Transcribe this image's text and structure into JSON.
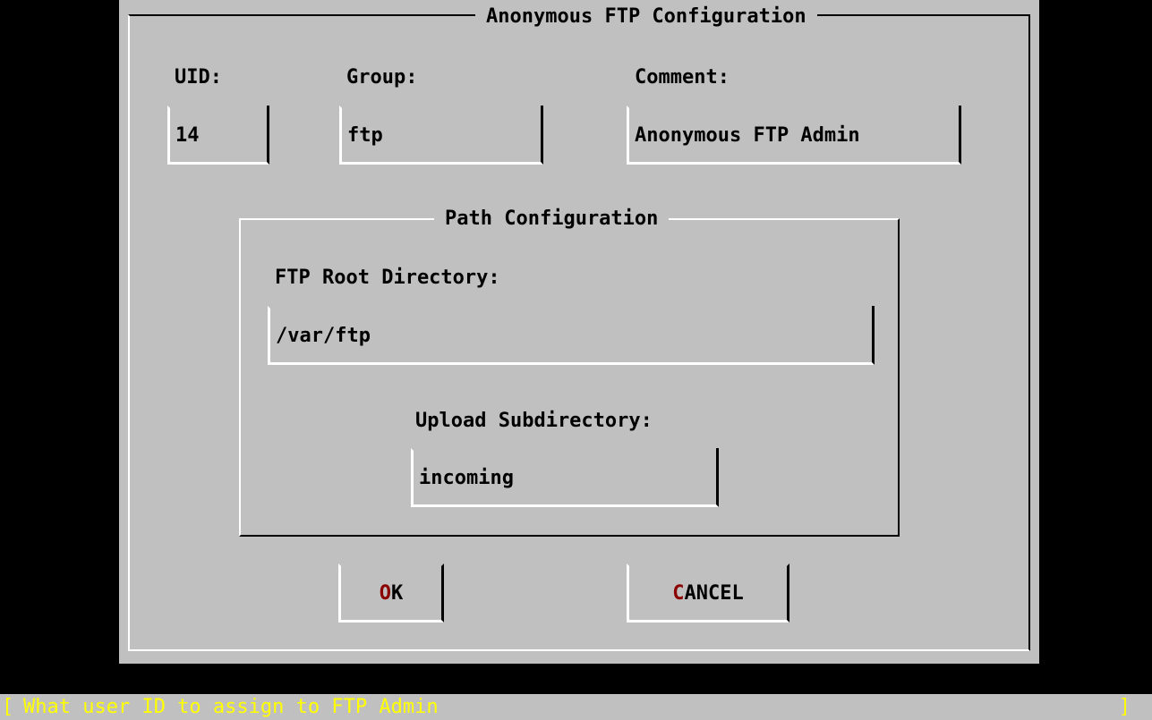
{
  "dialog": {
    "title": "Anonymous FTP Configuration",
    "uid": {
      "label": "UID:",
      "value": "14"
    },
    "group": {
      "label": "Group:",
      "value": "ftp"
    },
    "comment": {
      "label": "Comment:",
      "value": "Anonymous FTP Admin"
    },
    "path_config": {
      "title": "Path Configuration",
      "root_dir": {
        "label": "FTP Root Directory:",
        "value": "/var/ftp"
      },
      "upload_dir": {
        "label": "Upload Subdirectory:",
        "value": "incoming"
      }
    },
    "buttons": {
      "ok": {
        "hotkey": "O",
        "rest": "K"
      },
      "cancel": {
        "hotkey": "C",
        "rest": "ANCEL"
      }
    }
  },
  "status_bar": {
    "left_bracket": "[",
    "text": "What user ID to assign to FTP Admin",
    "right_bracket": "]"
  },
  "colors": {
    "background": "#000000",
    "dialog": "#c0c0c0",
    "hotkey": "#8b0000",
    "status_text": "#ffff00"
  }
}
